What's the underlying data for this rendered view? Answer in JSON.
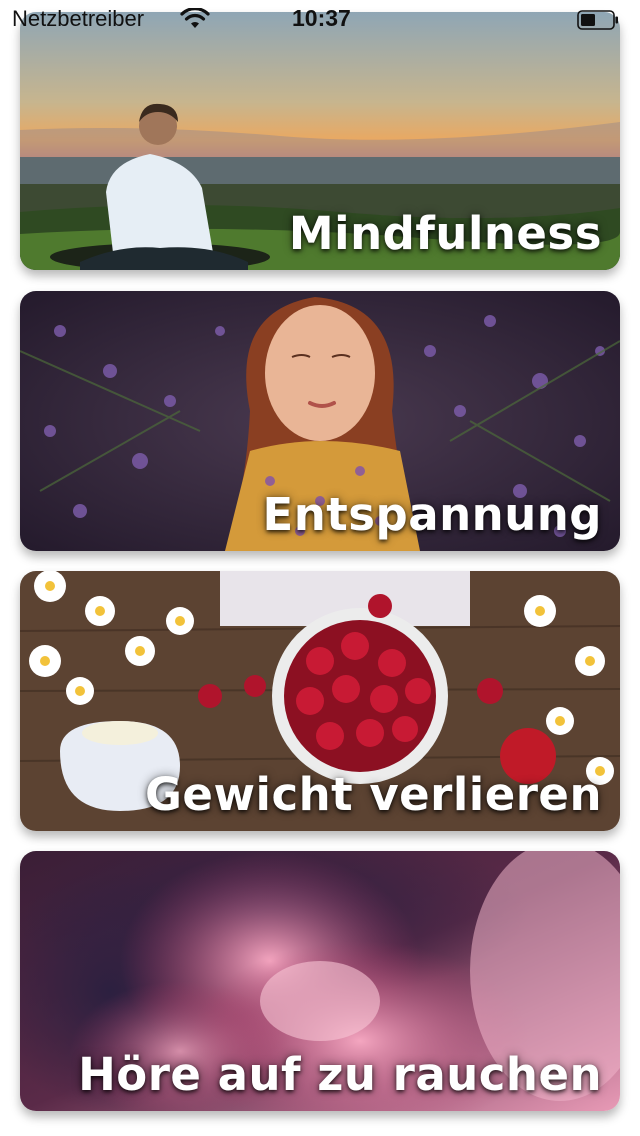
{
  "status_bar": {
    "carrier": "Netzbetreiber",
    "time": "10:37",
    "icons": [
      "wifi-icon",
      "battery-icon"
    ]
  },
  "categories": [
    {
      "title": "Mindfulness",
      "image": "meditation-sunset-image"
    },
    {
      "title": "Entspannung",
      "image": "girl-lavender-image"
    },
    {
      "title": "Gewicht verlieren",
      "image": "raspberries-daisies-image"
    },
    {
      "title": "Höre auf zu rauchen",
      "image": "pink-smoke-image"
    }
  ],
  "colors": {
    "title_text": "#ffffff",
    "background": "#ffffff"
  }
}
